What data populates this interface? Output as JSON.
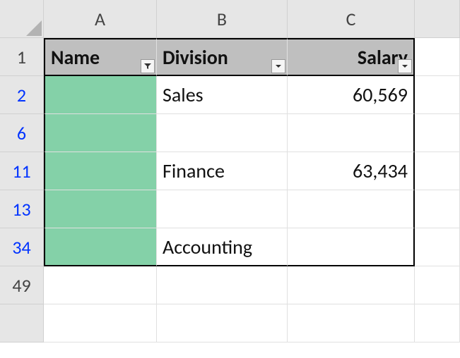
{
  "columns": {
    "A": "A",
    "B": "B",
    "C": "C"
  },
  "visible_row_numbers": [
    "1",
    "2",
    "6",
    "11",
    "13",
    "34",
    "49"
  ],
  "header": {
    "name": "Name",
    "division": "Division",
    "salary": "Salary"
  },
  "rows": [
    {
      "name": "",
      "division": "Sales",
      "salary": "60,569"
    },
    {
      "name": "",
      "division": "",
      "salary": ""
    },
    {
      "name": "",
      "division": "Finance",
      "salary": "63,434"
    },
    {
      "name": "",
      "division": "",
      "salary": ""
    },
    {
      "name": "",
      "division": "Accounting",
      "salary": ""
    }
  ],
  "chart_data": {
    "type": "table",
    "columns": [
      "Name",
      "Division",
      "Salary"
    ],
    "rows": [
      {
        "row": 2,
        "Name": "",
        "Division": "Sales",
        "Salary": 60569
      },
      {
        "row": 6,
        "Name": "",
        "Division": "",
        "Salary": null
      },
      {
        "row": 11,
        "Name": "",
        "Division": "Finance",
        "Salary": 63434
      },
      {
        "row": 13,
        "Name": "",
        "Division": "",
        "Salary": null
      },
      {
        "row": 34,
        "Name": "",
        "Division": "Accounting",
        "Salary": null
      }
    ],
    "filter_active_on": [
      "Name"
    ]
  }
}
